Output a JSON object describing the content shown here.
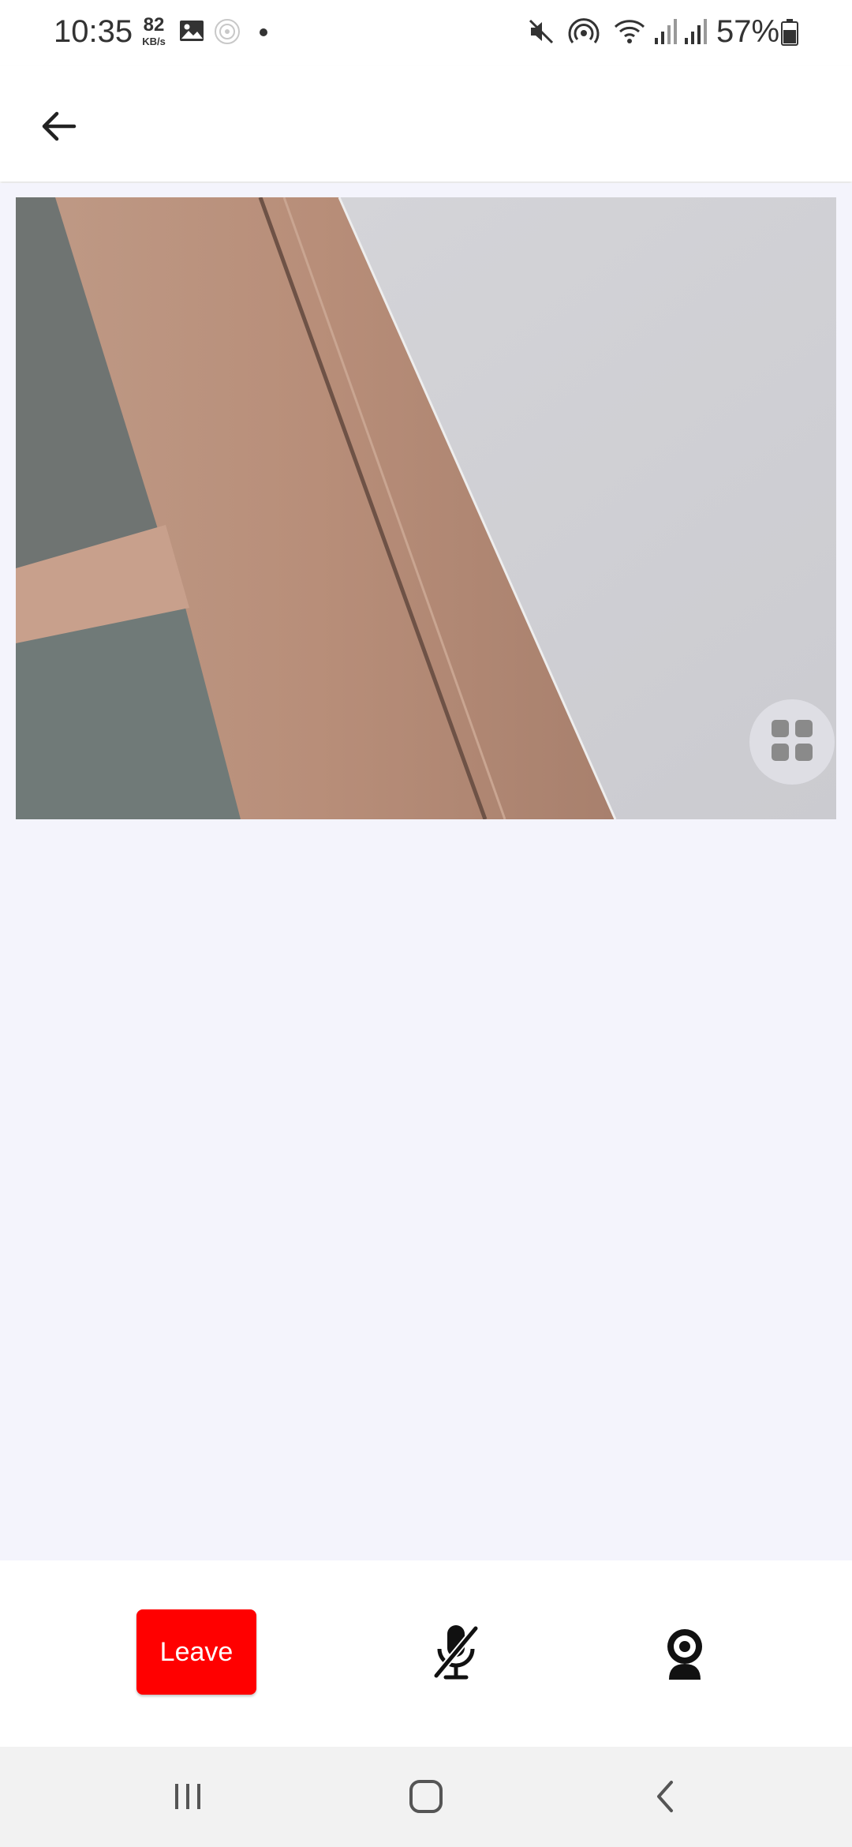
{
  "status_bar": {
    "time": "10:35",
    "net_speed_value": "82",
    "net_speed_unit": "KB/s",
    "battery_percent": "57%",
    "icons": [
      "gallery-icon",
      "vpn-icon",
      "dot-icon",
      "mute-icon",
      "hotspot-icon",
      "wifi-icon",
      "signal-icon",
      "signal-icon",
      "battery-icon"
    ]
  },
  "app_bar": {
    "back_icon": "arrow-left-icon"
  },
  "video": {
    "layout_toggle_icon": "grid-icon"
  },
  "controls": {
    "leave_label": "Leave",
    "leave_color": "#ff0000",
    "mic_icon": "mic-off-icon",
    "camera_icon": "webcam-icon"
  },
  "nav_bar": {
    "icons": [
      "recent-apps-icon",
      "home-icon",
      "back-icon"
    ]
  },
  "colors": {
    "content_bg": "#f4f4fc",
    "accent": "#ff0000"
  }
}
